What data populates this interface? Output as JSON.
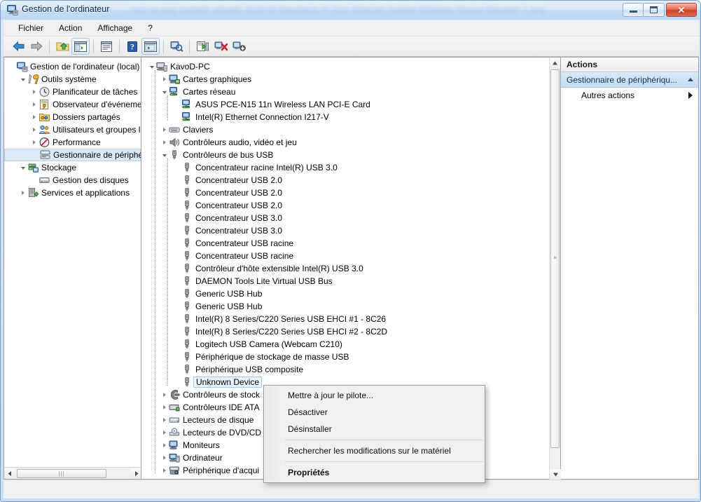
{
  "window": {
    "title": "Gestion de l'ordinateur",
    "blurred_title_suffix": "com na aeg contenti uploads 2016 06 Raspberry Pi Zero Ethernet Gadget Windows Device Manager 1 png",
    "buttons": {
      "minimize": "Réduire",
      "maximize": "Agrandir",
      "close": "Fermer"
    }
  },
  "menubar": {
    "items": [
      "Fichier",
      "Action",
      "Affichage",
      "?"
    ]
  },
  "toolbar": {
    "items": [
      "back-icon",
      "forward-icon",
      "separator",
      "up-folder-icon",
      "show-hide-console-tree-icon",
      "separator",
      "properties-icon",
      "separator",
      "help-icon",
      "show-action-pane-icon",
      "separator",
      "scan-hardware-icon",
      "separator",
      "update-driver-icon",
      "disable-device-icon",
      "uninstall-device-icon"
    ]
  },
  "left_tree": {
    "items": [
      {
        "label": "Gestion de l'ordinateur (local)",
        "indent": 0,
        "expander": "none",
        "icon": "computer-management-icon",
        "selected": false
      },
      {
        "label": "Outils système",
        "indent": 1,
        "expander": "open",
        "icon": "system-tools-icon",
        "selected": false
      },
      {
        "label": "Planificateur de tâches",
        "indent": 2,
        "expander": "closed",
        "icon": "clock-icon",
        "selected": false
      },
      {
        "label": "Observateur d'événeme",
        "indent": 2,
        "expander": "closed",
        "icon": "event-viewer-icon",
        "selected": false
      },
      {
        "label": "Dossiers partagés",
        "indent": 2,
        "expander": "closed",
        "icon": "shared-folders-icon",
        "selected": false
      },
      {
        "label": "Utilisateurs et groupes l",
        "indent": 2,
        "expander": "closed",
        "icon": "users-groups-icon",
        "selected": false
      },
      {
        "label": "Performance",
        "indent": 2,
        "expander": "closed",
        "icon": "performance-icon",
        "selected": false
      },
      {
        "label": "Gestionnaire de périphé",
        "indent": 2,
        "expander": "none",
        "icon": "device-manager-icon",
        "selected": true
      },
      {
        "label": "Stockage",
        "indent": 1,
        "expander": "open",
        "icon": "storage-icon",
        "selected": false
      },
      {
        "label": "Gestion des disques",
        "indent": 2,
        "expander": "none",
        "icon": "disk-management-icon",
        "selected": false
      },
      {
        "label": "Services et applications",
        "indent": 1,
        "expander": "closed",
        "icon": "services-apps-icon",
        "selected": false
      }
    ],
    "hscroll": {
      "left_arrow": "◄",
      "right_arrow": "►",
      "grip": "‖"
    }
  },
  "device_tree": {
    "items": [
      {
        "label": "KavoD-PC",
        "indent": 0,
        "expander": "open",
        "icon": "pc-icon",
        "selected": false
      },
      {
        "label": "Cartes graphiques",
        "indent": 1,
        "expander": "closed",
        "icon": "display-icon",
        "selected": false
      },
      {
        "label": "Cartes réseau",
        "indent": 1,
        "expander": "open",
        "icon": "network-icon",
        "selected": false
      },
      {
        "label": "ASUS PCE-N15 11n Wireless LAN PCI-E Card",
        "indent": 2,
        "expander": "none",
        "icon": "network-icon",
        "selected": false
      },
      {
        "label": "Intel(R) Ethernet Connection I217-V",
        "indent": 2,
        "expander": "none",
        "icon": "network-icon",
        "selected": false
      },
      {
        "label": "Claviers",
        "indent": 1,
        "expander": "closed",
        "icon": "keyboard-icon",
        "selected": false
      },
      {
        "label": "Contrôleurs audio, vidéo et jeu",
        "indent": 1,
        "expander": "closed",
        "icon": "audio-icon",
        "selected": false
      },
      {
        "label": "Contrôleurs de bus USB",
        "indent": 1,
        "expander": "open",
        "icon": "usb-icon",
        "selected": false
      },
      {
        "label": "Concentrateur racine Intel(R) USB 3.0",
        "indent": 2,
        "expander": "none",
        "icon": "usb-icon",
        "selected": false
      },
      {
        "label": "Concentrateur USB 2.0",
        "indent": 2,
        "expander": "none",
        "icon": "usb-icon",
        "selected": false
      },
      {
        "label": "Concentrateur USB 2.0",
        "indent": 2,
        "expander": "none",
        "icon": "usb-icon",
        "selected": false
      },
      {
        "label": "Concentrateur USB 2.0",
        "indent": 2,
        "expander": "none",
        "icon": "usb-icon",
        "selected": false
      },
      {
        "label": "Concentrateur USB 3.0",
        "indent": 2,
        "expander": "none",
        "icon": "usb-icon",
        "selected": false
      },
      {
        "label": "Concentrateur USB 3.0",
        "indent": 2,
        "expander": "none",
        "icon": "usb-icon",
        "selected": false
      },
      {
        "label": "Concentrateur USB racine",
        "indent": 2,
        "expander": "none",
        "icon": "usb-icon",
        "selected": false
      },
      {
        "label": "Concentrateur USB racine",
        "indent": 2,
        "expander": "none",
        "icon": "usb-icon",
        "selected": false
      },
      {
        "label": "Contrôleur d'hôte extensible Intel(R) USB 3.0",
        "indent": 2,
        "expander": "none",
        "icon": "usb-icon",
        "selected": false
      },
      {
        "label": "DAEMON Tools Lite Virtual USB Bus",
        "indent": 2,
        "expander": "none",
        "icon": "usb-icon",
        "selected": false
      },
      {
        "label": "Generic USB Hub",
        "indent": 2,
        "expander": "none",
        "icon": "usb-icon",
        "selected": false
      },
      {
        "label": "Generic USB Hub",
        "indent": 2,
        "expander": "none",
        "icon": "usb-icon",
        "selected": false
      },
      {
        "label": "Intel(R) 8 Series/C220 Series USB EHCI #1 - 8C26",
        "indent": 2,
        "expander": "none",
        "icon": "usb-icon",
        "selected": false
      },
      {
        "label": "Intel(R) 8 Series/C220 Series USB EHCI #2 - 8C2D",
        "indent": 2,
        "expander": "none",
        "icon": "usb-icon",
        "selected": false
      },
      {
        "label": "Logitech USB Camera (Webcam C210)",
        "indent": 2,
        "expander": "none",
        "icon": "usb-icon",
        "selected": false
      },
      {
        "label": "Périphérique de stockage de masse USB",
        "indent": 2,
        "expander": "none",
        "icon": "usb-icon",
        "selected": false
      },
      {
        "label": "Périphérique USB composite",
        "indent": 2,
        "expander": "none",
        "icon": "usb-icon",
        "selected": false
      },
      {
        "label": "Unknown Device",
        "indent": 2,
        "expander": "none",
        "icon": "usb-icon",
        "selected": true
      },
      {
        "label": "Contrôleurs de stock",
        "indent": 1,
        "expander": "closed",
        "icon": "storage-ctrl-icon",
        "selected": false
      },
      {
        "label": "Contrôleurs IDE ATA",
        "indent": 1,
        "expander": "closed",
        "icon": "ide-icon",
        "selected": false
      },
      {
        "label": "Lecteurs de disque",
        "indent": 1,
        "expander": "closed",
        "icon": "disk-icon",
        "selected": false
      },
      {
        "label": "Lecteurs de DVD/CD",
        "indent": 1,
        "expander": "closed",
        "icon": "dvd-icon",
        "selected": false
      },
      {
        "label": "Moniteurs",
        "indent": 1,
        "expander": "closed",
        "icon": "monitor-icon",
        "selected": false
      },
      {
        "label": "Ordinateur",
        "indent": 1,
        "expander": "closed",
        "icon": "computer-icon",
        "selected": false
      },
      {
        "label": "Périphérique d'acqui",
        "indent": 1,
        "expander": "closed",
        "icon": "imaging-icon",
        "selected": false
      }
    ]
  },
  "actions_panel": {
    "title": "Actions",
    "header_label": "Gestionnaire de périphériqu...",
    "items": [
      {
        "label": "Autres actions",
        "submenu": true
      }
    ]
  },
  "context_menu": {
    "items": [
      {
        "label": "Mettre à jour le pilote...",
        "bold": false,
        "separator_after": false
      },
      {
        "label": "Désactiver",
        "bold": false,
        "separator_after": false
      },
      {
        "label": "Désinstaller",
        "bold": false,
        "separator_after": true
      },
      {
        "label": "Rechercher les modifications sur le matériel",
        "bold": false,
        "separator_after": true
      },
      {
        "label": "Propriétés",
        "bold": true,
        "separator_after": false
      }
    ]
  },
  "colors": {
    "titlebar": "#cfe2f5",
    "selection": "#dceaf8",
    "selection_border": "#9dc7ea",
    "actions_header": "#c3dcf3",
    "close_button": "#cf3f28"
  }
}
